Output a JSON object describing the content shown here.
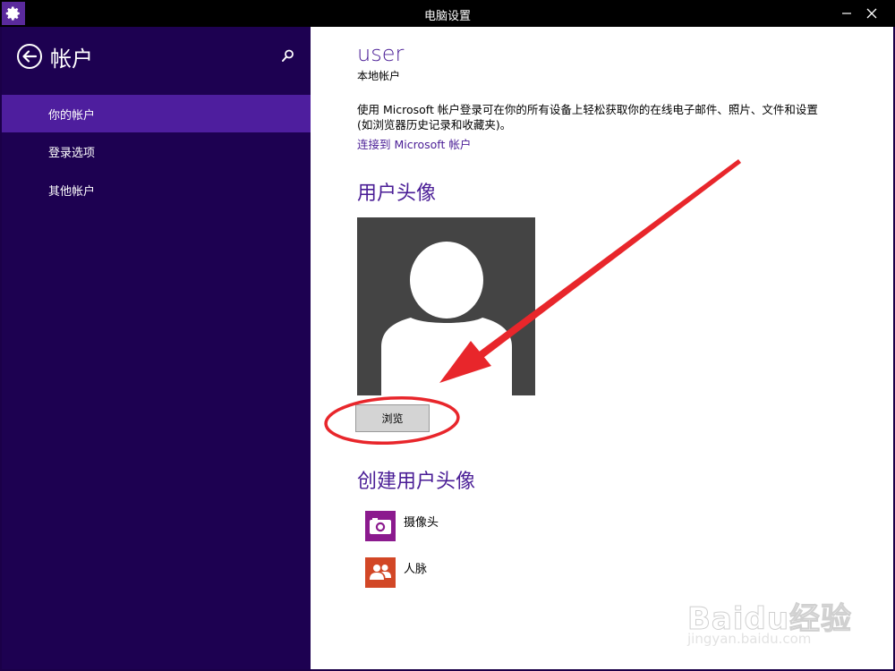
{
  "window": {
    "title": "电脑设置",
    "minimize_glyph": "—",
    "close_glyph": "✕",
    "app_icon": "gear-icon"
  },
  "sidebar": {
    "title": "帐户",
    "back_icon": "back-arrow-icon",
    "search_icon": "search-icon",
    "items": [
      {
        "label": "你的帐户",
        "active": true
      },
      {
        "label": "登录选项",
        "active": false
      },
      {
        "label": "其他帐户",
        "active": false
      }
    ]
  },
  "main": {
    "user_name": "user",
    "account_type": "本地帐户",
    "description": "使用 Microsoft 帐户登录可在你的所有设备上轻松获取你的在线电子邮件、照片、文件和设置(如浏览器历史记录和收藏夹)。",
    "connect_link": "连接到 Microsoft 帐户",
    "avatar_section_title": "用户头像",
    "browse_button": "浏览",
    "create_section_title": "创建用户头像",
    "create_items": [
      {
        "label": "摄像头",
        "icon": "camera-icon",
        "color": "#8b1a8e"
      },
      {
        "label": "人脉",
        "icon": "people-icon",
        "color": "#d24726"
      }
    ]
  },
  "watermark": {
    "brand": "Baidu经验",
    "url": "jingyan.baidu.com"
  },
  "colors": {
    "accent": "#4a1d96",
    "sidebar_bg": "#1d0151",
    "active_item": "#4e1e9e",
    "annotation": "#e8262b"
  }
}
